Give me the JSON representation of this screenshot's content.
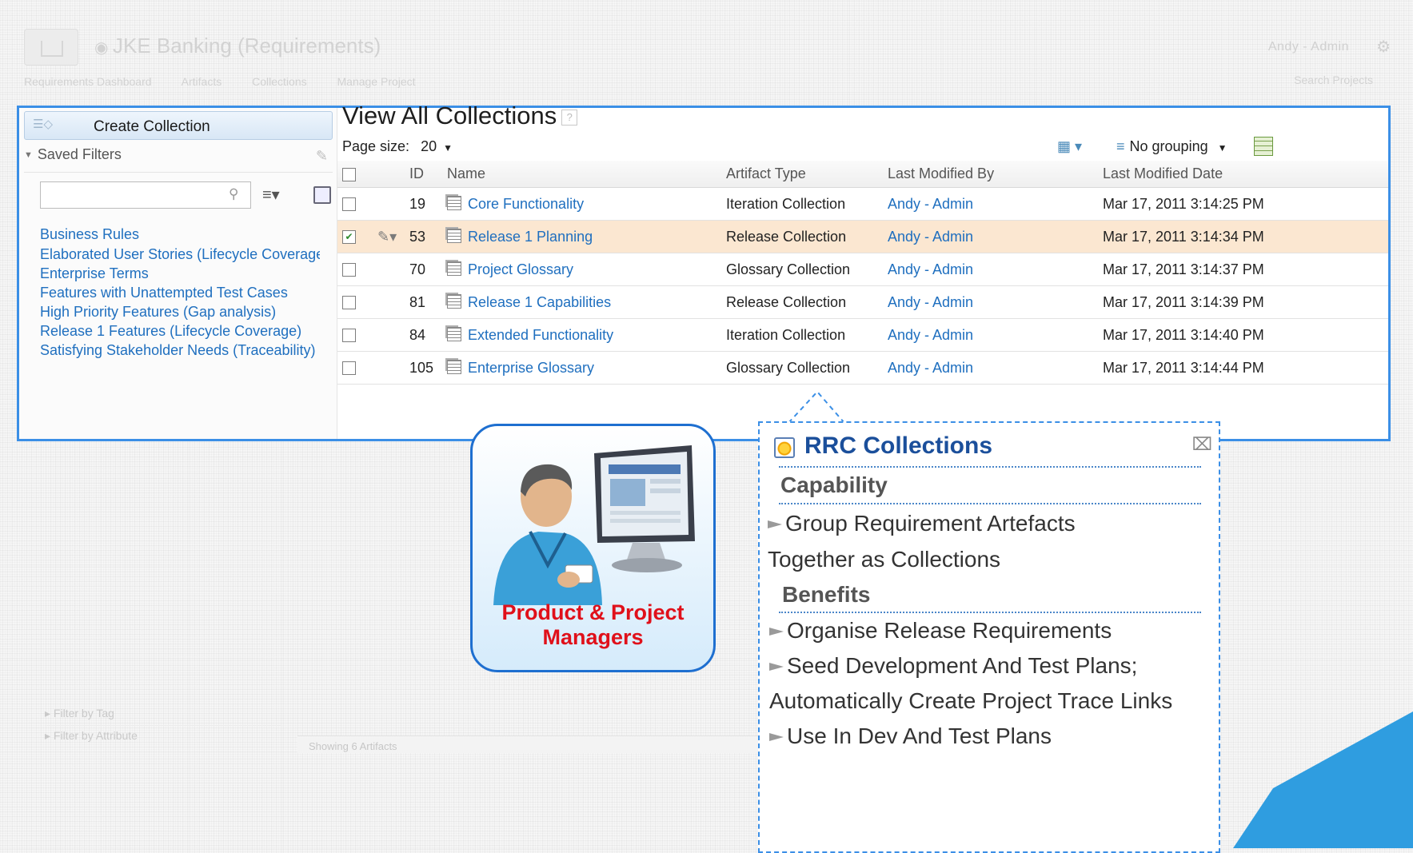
{
  "app": {
    "title": "JKE Banking (Requirements)",
    "user": "Andy - Admin",
    "breadcrumb": [
      "Requirements Dashboard",
      "Artifacts",
      "Collections",
      "Manage Project"
    ],
    "search_placeholder": "Search Projects"
  },
  "sidebar": {
    "create_label": "Create Collection",
    "saved_filters_label": "Saved Filters",
    "filter_placeholder": "",
    "filters": [
      "Business Rules",
      "Elaborated User Stories (Lifecycle Coverage)",
      "Enterprise Terms",
      "Features with Unattempted Test Cases",
      "High Priority Features (Gap analysis)",
      "Release 1 Features (Lifecycle Coverage)",
      "Satisfying Stakeholder Needs (Traceability)"
    ],
    "filter_by_tag": "Filter by Tag",
    "filter_by_attribute": "Filter by Attribute"
  },
  "main": {
    "title": "View All Collections",
    "page_size_label": "Page size:",
    "page_size_value": "20",
    "grouping": "No grouping",
    "columns": [
      "ID",
      "Name",
      "Artifact Type",
      "Last Modified By",
      "Last Modified Date"
    ],
    "rows": [
      {
        "id": "19",
        "name": "Core Functionality",
        "type": "Iteration Collection",
        "by": "Andy - Admin",
        "date": "Mar 17, 2011 3:14:25 PM",
        "checked": false
      },
      {
        "id": "53",
        "name": "Release 1 Planning",
        "type": "Release Collection",
        "by": "Andy - Admin",
        "date": "Mar 17, 2011 3:14:34 PM",
        "checked": true
      },
      {
        "id": "70",
        "name": "Project Glossary",
        "type": "Glossary Collection",
        "by": "Andy - Admin",
        "date": "Mar 17, 2011 3:14:37 PM",
        "checked": false
      },
      {
        "id": "81",
        "name": "Release 1 Capabilities",
        "type": "Release Collection",
        "by": "Andy - Admin",
        "date": "Mar 17, 2011 3:14:39 PM",
        "checked": false
      },
      {
        "id": "84",
        "name": "Extended Functionality",
        "type": "Iteration Collection",
        "by": "Andy - Admin",
        "date": "Mar 17, 2011 3:14:40 PM",
        "checked": false
      },
      {
        "id": "105",
        "name": "Enterprise Glossary",
        "type": "Glossary Collection",
        "by": "Andy - Admin",
        "date": "Mar 17, 2011 3:14:44 PM",
        "checked": false
      }
    ],
    "showing": "Showing 6 Artifacts"
  },
  "role_card": {
    "line1": "Product & Project",
    "line2": "Managers"
  },
  "callout": {
    "title": "RRC Collections",
    "capability_heading": "Capability",
    "capability_lines": [
      "Group Requirement Artefacts",
      "Together as Collections"
    ],
    "benefits_heading": "Benefits",
    "benefit_lines": [
      "Organise Release Requirements",
      "Seed Development And Test Plans;",
      "Automatically Create Project Trace Links",
      "Use In Dev And Test Plans"
    ]
  },
  "colors": {
    "accent": "#3b8fe6",
    "link": "#1f6fbf",
    "role_text": "#e0101a",
    "callout_title": "#1b4f9b",
    "selected_row": "#fbe7d1"
  },
  "icons": [
    "home-icon",
    "search-icon",
    "list-view-icon",
    "save-icon",
    "pencil-icon",
    "help-icon",
    "columns-icon",
    "grouping-icon",
    "grid-icon",
    "collection-icon",
    "edit-icon",
    "rrc-icon",
    "close-icon",
    "bullet-arrow-icon"
  ]
}
